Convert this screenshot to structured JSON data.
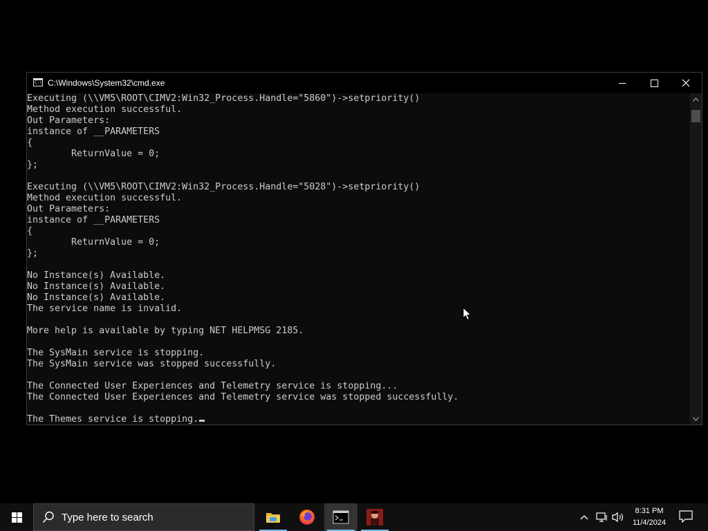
{
  "window": {
    "title": "C:\\Windows\\System32\\cmd.exe",
    "icon": "cmd-app-icon",
    "icon_text": "C:\\"
  },
  "console": {
    "lines": [
      "Executing (\\\\VM5\\ROOT\\CIMV2:Win32_Process.Handle=\"5860\")->setpriority()",
      "Method execution successful.",
      "Out Parameters:",
      "instance of __PARAMETERS",
      "{",
      "        ReturnValue = 0;",
      "};",
      "",
      "Executing (\\\\VM5\\ROOT\\CIMV2:Win32_Process.Handle=\"5028\")->setpriority()",
      "Method execution successful.",
      "Out Parameters:",
      "instance of __PARAMETERS",
      "{",
      "        ReturnValue = 0;",
      "};",
      "",
      "No Instance(s) Available.",
      "No Instance(s) Available.",
      "No Instance(s) Available.",
      "The service name is invalid.",
      "",
      "More help is available by typing NET HELPMSG 2185.",
      "",
      "The SysMain service is stopping.",
      "The SysMain service was stopped successfully.",
      "",
      "The Connected User Experiences and Telemetry service is stopping...",
      "The Connected User Experiences and Telemetry service was stopped successfully.",
      "",
      "The Themes service is stopping."
    ],
    "text_color": "#cccccc",
    "background": "#0c0c0c"
  },
  "taskbar": {
    "search_placeholder": "Type here to search",
    "apps": [
      {
        "name": "file-explorer-icon",
        "active": false,
        "running": true
      },
      {
        "name": "firefox-icon",
        "active": false,
        "running": false
      },
      {
        "name": "command-prompt-icon",
        "active": true,
        "running": true
      },
      {
        "name": "app-thumbnail-icon",
        "active": false,
        "running": true
      }
    ],
    "clock": {
      "time": "8:31 PM",
      "date": "11/4/2024"
    },
    "accent": "#76b9ed"
  }
}
